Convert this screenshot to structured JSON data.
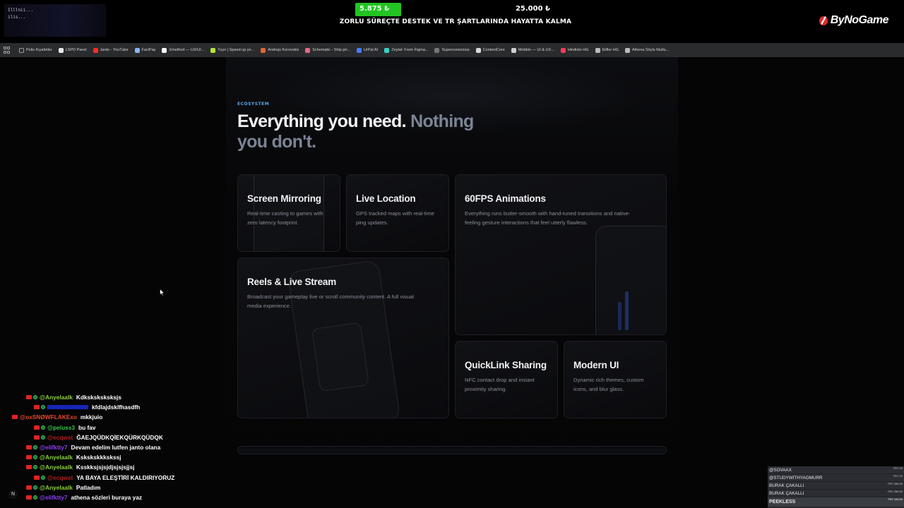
{
  "overlay": {
    "webcam_lines": [
      "Illlnii...",
      "ilis..."
    ],
    "donation_goal": {
      "current": "5.875 ₺",
      "goal": "25.000 ₺",
      "progress_fraction": 0.235,
      "title": "ZORLU SÜREÇTE DESTEK VE TR ŞARTLARINDA HAYATTA KALMA",
      "bar_color": "#22c322"
    },
    "brand": "ByNoGame"
  },
  "bookmarks": [
    {
      "label": "Polis Kıyafetler",
      "icon": "folder-icon",
      "color": "#9aa0a6"
    },
    {
      "label": "LSPD Panel",
      "icon": "star-badge-icon",
      "color": "#e8e8e8"
    },
    {
      "label": "Janto - YouTube",
      "icon": "youtube-icon",
      "color": "#ff2a2a"
    },
    {
      "label": "FaciPay",
      "icon": "facipay-icon",
      "color": "#8ab4f8"
    },
    {
      "label": "Xmethod — UX/UI...",
      "icon": "x-icon",
      "color": "#ffffff"
    },
    {
      "label": "Tuyo | Speed up yo...",
      "icon": "tuyo-icon",
      "color": "#b6e33a"
    },
    {
      "label": "Andrejs Korovskis",
      "icon": "andrejs-icon",
      "color": "#e2643a"
    },
    {
      "label": "Schematic - Ship pri...",
      "icon": "schematic-icon",
      "color": "#e26b8a"
    },
    {
      "label": "UrPal AI",
      "icon": "urpal-icon",
      "color": "#4a7bff"
    },
    {
      "label": "Zeytal: From Figma...",
      "icon": "zeytal-icon",
      "color": "#3ad1c4"
    },
    {
      "label": "Superconscious",
      "icon": "superconscious-icon",
      "color": "#777777"
    },
    {
      "label": "ContentCore",
      "icon": "contentcore-icon",
      "color": "#d9d9d9"
    },
    {
      "label": "Mobbin — UI & UX...",
      "icon": "mobbin-icon",
      "color": "#cfcfcf"
    },
    {
      "label": "Hindisto HG",
      "icon": "hindisto-icon",
      "color": "#ff3b5c"
    },
    {
      "label": "Elifler HG",
      "icon": "elifler-icon",
      "color": "#bbbbbb"
    },
    {
      "label": "Athena Söyle Mutlu...",
      "icon": "athena-icon",
      "color": "#bbbbbb"
    }
  ],
  "page": {
    "eyebrow": "ECOSYSTEM",
    "headline_primary": "Everything you need.",
    "headline_muted": "Nothing you don't.",
    "accent_color": "#5aa7e8",
    "cards": {
      "mirroring": {
        "title": "Screen Mirroring",
        "desc": "Real-time casting to games with zero latency footprint."
      },
      "location": {
        "title": "Live Location",
        "desc": "GPS tracked maps with real-time ping updates."
      },
      "animations": {
        "title": "60FPS Animations",
        "desc": "Everything runs butter-smooth with hand-tuned transitions and native-feeling gesture interactions that feel utterly flawless."
      },
      "reels": {
        "title": "Reels & Live Stream",
        "desc": "Broadcast your gameplay live or scroll community content. A full visual media experience."
      },
      "quicklink": {
        "title": "QuickLink Sharing",
        "desc": "NFC contact drop and instant proximity sharing."
      },
      "modern": {
        "title": "Modern UI",
        "desc": "Dynamic rich themes, custom icons, and blur glass."
      }
    }
  },
  "chat": {
    "n_badge": "N",
    "messages": [
      {
        "user": "@Anyelaalk",
        "text": "Kdksksksksksjs",
        "color": "#8bd03a",
        "badges": 2,
        "indent": 1
      },
      {
        "user": "",
        "text": "kfdlajdsklfhasdfh",
        "color": "#1a2dd6",
        "badges": 2,
        "indent": 2
      },
      {
        "user": "@oxSNØWFLAKExo",
        "text": "mkkjuio",
        "color": "#e8452c",
        "badges": 1,
        "indent": 0
      },
      {
        "user": "@peluss3",
        "text": "bu fav",
        "color": "#39c24a",
        "badges": 2,
        "indent": 2
      },
      {
        "user": "@ecqwst",
        "text": "ĞAEJQÜDKQİEKQÜRKQÜDQK",
        "color": "#b51d1d",
        "badges": 2,
        "indent": 2
      },
      {
        "user": "@elifktty7",
        "text": "Devam edelim lutfen janto olana",
        "color": "#8a3df0",
        "badges": 2,
        "indent": 1
      },
      {
        "user": "@Anyelaalk",
        "text": "Kskskskkkskssj",
        "color": "#8bd03a",
        "badges": 2,
        "indent": 1
      },
      {
        "user": "@Anyelaalk",
        "text": "Ksskksjsjsjdjsjsjsjjsj",
        "color": "#8bd03a",
        "badges": 2,
        "indent": 1
      },
      {
        "user": "@ecqwst",
        "text": "YA BAYA ELEŞTİRİ KALDIRIYORUZ",
        "color": "#b51d1d",
        "badges": 2,
        "indent": 2
      },
      {
        "user": "@Anyelaalk",
        "text": "Patladım",
        "color": "#8bd03a",
        "badges": 2,
        "indent": 1
      },
      {
        "user": "@elifktty7",
        "text": "athena sözleri buraya yaz",
        "color": "#8a3df0",
        "badges": 2,
        "indent": 1
      }
    ]
  },
  "donations": [
    {
      "name": "@SOVAAX",
      "amount": "TRY 22"
    },
    {
      "name": "@STUDYWITHYAGMURR",
      "amount": "TRY 22"
    },
    {
      "name": "BURAK ÇAKALLI",
      "amount": "TRY 250.00"
    },
    {
      "name": "BURAK ÇAKALLI",
      "amount": "TRY 250.00"
    },
    {
      "name": "PEEKLESS",
      "amount": "TRY 100.00"
    }
  ]
}
